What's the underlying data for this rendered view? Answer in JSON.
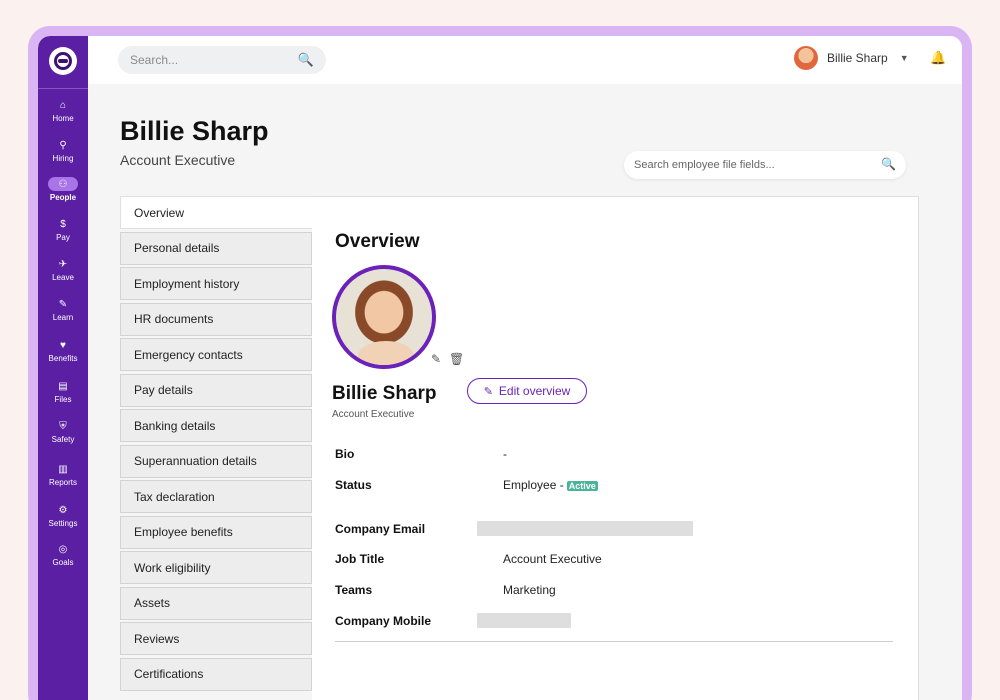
{
  "sidebar": {
    "items": [
      {
        "label": "Home",
        "icon": "⌂"
      },
      {
        "label": "Hiring",
        "icon": "⚲"
      },
      {
        "label": "People",
        "icon": "⚇"
      },
      {
        "label": "Pay",
        "icon": "$"
      },
      {
        "label": "Leave",
        "icon": "✈"
      },
      {
        "label": "Learn",
        "icon": "✎"
      },
      {
        "label": "Benefits",
        "icon": "♥"
      },
      {
        "label": "Files",
        "icon": "▤"
      },
      {
        "label": "Safety",
        "icon": "⛨"
      },
      {
        "label": "Reports",
        "icon": "▥"
      },
      {
        "label": "Settings",
        "icon": "⚙"
      },
      {
        "label": "Goals",
        "icon": "◎"
      }
    ],
    "active": "People"
  },
  "topbar": {
    "search_placeholder": "Search...",
    "user_name": "Billie Sharp",
    "caret": "▼",
    "bell": "🔔",
    "search_icon": "🔍"
  },
  "header": {
    "name": "Billie Sharp",
    "role": "Account Executive",
    "file_search_placeholder": "Search employee file fields..."
  },
  "menu": {
    "items": [
      "Overview",
      "Personal details",
      "Employment history",
      "HR documents",
      "Emergency contacts",
      "Pay details",
      "Banking details",
      "Superannuation details",
      "Tax declaration",
      "Employee benefits",
      "Work eligibility",
      "Assets",
      "Reviews",
      "Certifications"
    ],
    "active": "Overview"
  },
  "overview": {
    "title": "Overview",
    "name": "Billie Sharp",
    "role": "Account Executive",
    "edit_label": "Edit overview",
    "edit_icon": "✎",
    "delete_icon": "🗑",
    "fields": {
      "bio_label": "Bio",
      "bio_value": "-",
      "status_label": "Status",
      "status_value": "Employee -",
      "status_badge": "Active",
      "email_label": "Company Email",
      "job_label": "Job Title",
      "job_value": "Account Executive",
      "teams_label": "Teams",
      "teams_value": "Marketing",
      "mobile_label": "Company Mobile"
    }
  },
  "colors": {
    "sidebar": "#5a1fa2",
    "accent": "#6a22b8",
    "badge": "#4bb39a",
    "frame": "#d9b6f3"
  }
}
